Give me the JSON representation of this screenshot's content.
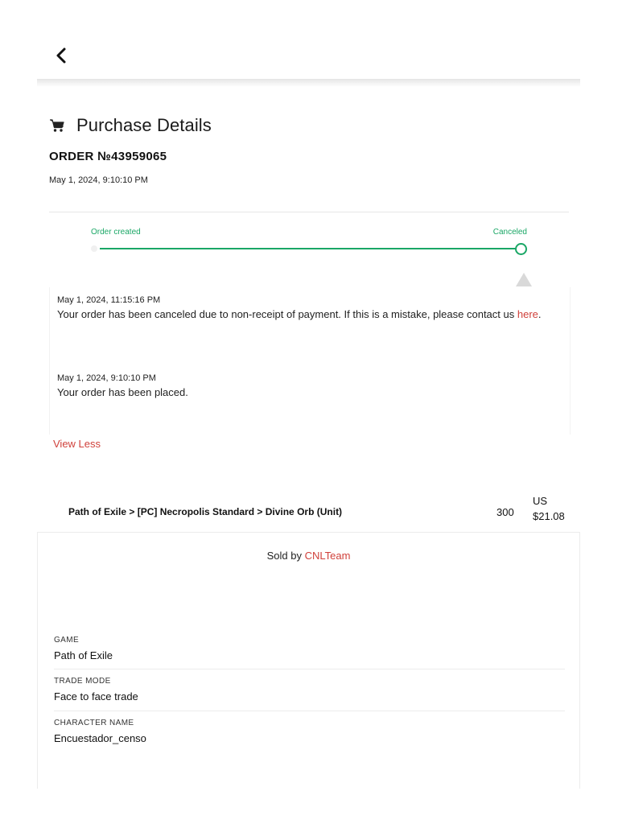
{
  "header": {
    "back_icon": "chevron-left-icon",
    "title_icon": "shopping-cart-icon",
    "title": "Purchase Details"
  },
  "order": {
    "number": "ORDER №43959065",
    "date": "May 1, 2024, 9:10:10 PM"
  },
  "progress": {
    "start_label": "Order created",
    "end_label": "Canceled",
    "accent_color": "#1aa766",
    "completion": 1.0
  },
  "history": [
    {
      "time": "May 1, 2024, 11:15:16 PM",
      "message": "Your order has been canceled due to non-receipt of payment. If this is a mistake, please contact us ",
      "link_text": "here",
      "trailing": "."
    },
    {
      "time": "May 1, 2024, 9:10:10 PM",
      "message": "Your order has been placed."
    }
  ],
  "view_less_label": "View Less",
  "product": {
    "path": "Path of Exile > [PC] Necropolis Standard > Divine Orb (Unit)",
    "quantity": "300",
    "currency": "US",
    "price": "$21.08"
  },
  "seller": {
    "prefix": "Sold by ",
    "name": "CNLTeam",
    "link_color": "#d0413b"
  },
  "fields": [
    {
      "label": "GAME",
      "value": "Path of Exile"
    },
    {
      "label": "TRADE MODE",
      "value": "Face to face trade"
    },
    {
      "label": "CHARACTER NAME",
      "value": "Encuestador_censo"
    }
  ]
}
